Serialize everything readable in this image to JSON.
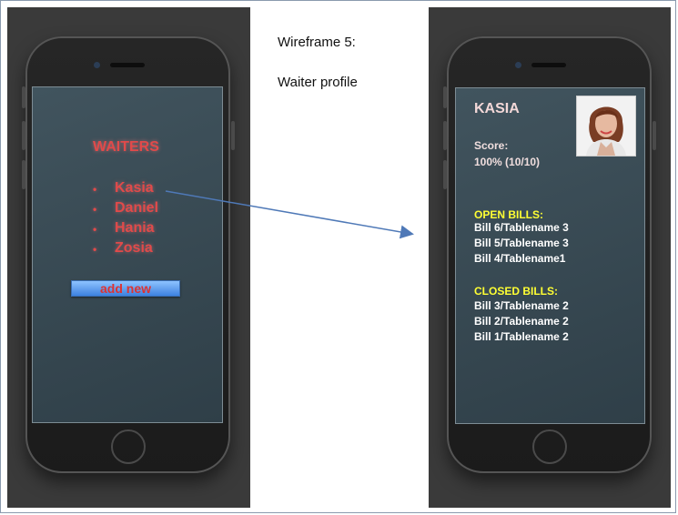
{
  "wireframe": {
    "title": "Wireframe 5:",
    "subtitle": "Waiter profile"
  },
  "left_screen": {
    "heading": "WAITERS",
    "waiters": [
      "Kasia",
      "Daniel",
      "Hania",
      "Zosia"
    ],
    "add_button_label": "add new"
  },
  "profile": {
    "name": "KASIA",
    "score_label": "Score:",
    "score_value": "100% (10/10)",
    "open_bills_label": "OPEN BILLS:",
    "open_bills": [
      "Bill 6/Tablename 3",
      "Bill 5/Tablename 3",
      "Bill 4/Tablename1"
    ],
    "closed_bills_label": "CLOSED BILLS:",
    "closed_bills": [
      "Bill 3/Tablename 2",
      "Bill 2/Tablename 2",
      "Bill 1/Tablename 2"
    ],
    "avatar_icon": "person-photo"
  },
  "colors": {
    "waiter_red": "#e14a4a",
    "bills_yellow": "#ffff33",
    "arrow_blue": "#4f79b7"
  }
}
